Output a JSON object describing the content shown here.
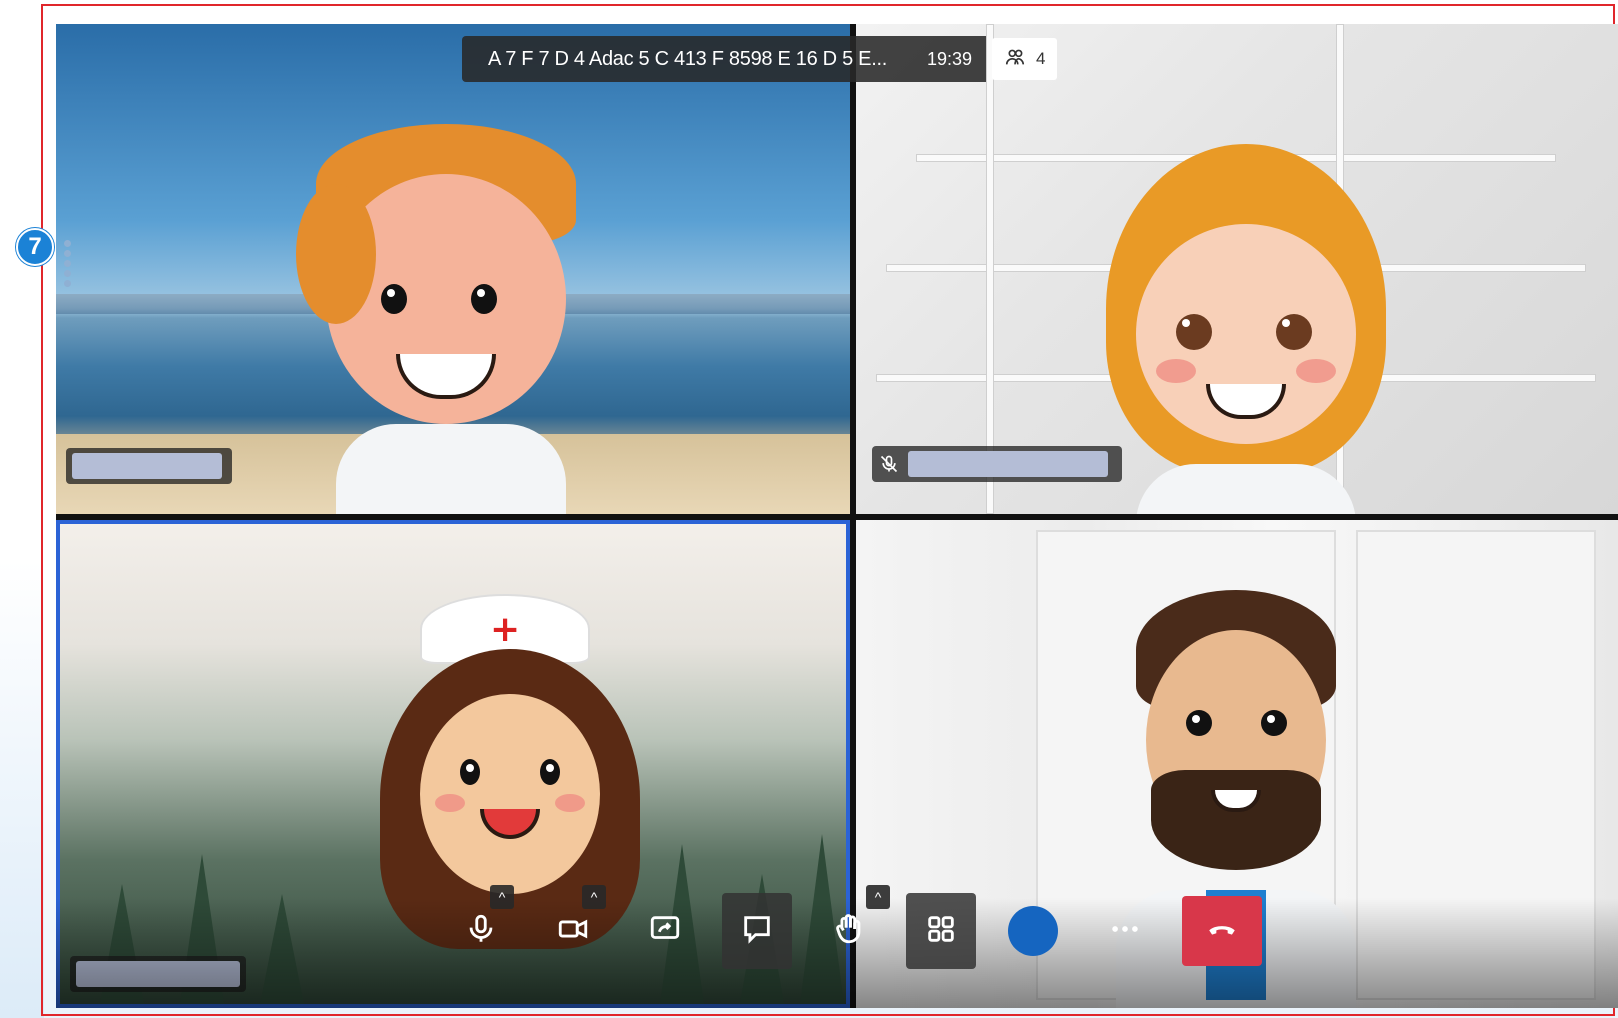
{
  "step": {
    "number": "7"
  },
  "meeting": {
    "title": "A 7 F 7 D 4 Adac 5 C 413 F 8598 E 16 D 5 E...",
    "timer": "19:39",
    "participant_count": "4"
  },
  "participants": [
    {
      "tile": "top-left",
      "muted": false
    },
    {
      "tile": "top-right",
      "muted": true
    },
    {
      "tile": "bottom-left",
      "muted": false,
      "active_speaker": true
    },
    {
      "tile": "bottom-right",
      "muted": false
    }
  ],
  "toolbar": {
    "buttons": [
      {
        "icon": "microphone-icon"
      },
      {
        "icon": "video-camera-icon"
      },
      {
        "icon": "share-screen-icon"
      },
      {
        "icon": "chat-icon"
      },
      {
        "icon": "raise-hand-icon"
      },
      {
        "icon": "grid-layout-icon"
      },
      {
        "icon": "record-icon"
      },
      {
        "icon": "more-icon"
      },
      {
        "icon": "end-call-icon"
      }
    ],
    "end_call_color": "#d8374a",
    "record_color": "#1565c0"
  },
  "colors": {
    "frame_border": "#e0262b",
    "step_badge": "#1b82d6",
    "active_speaker_border": "#2b63d6"
  }
}
